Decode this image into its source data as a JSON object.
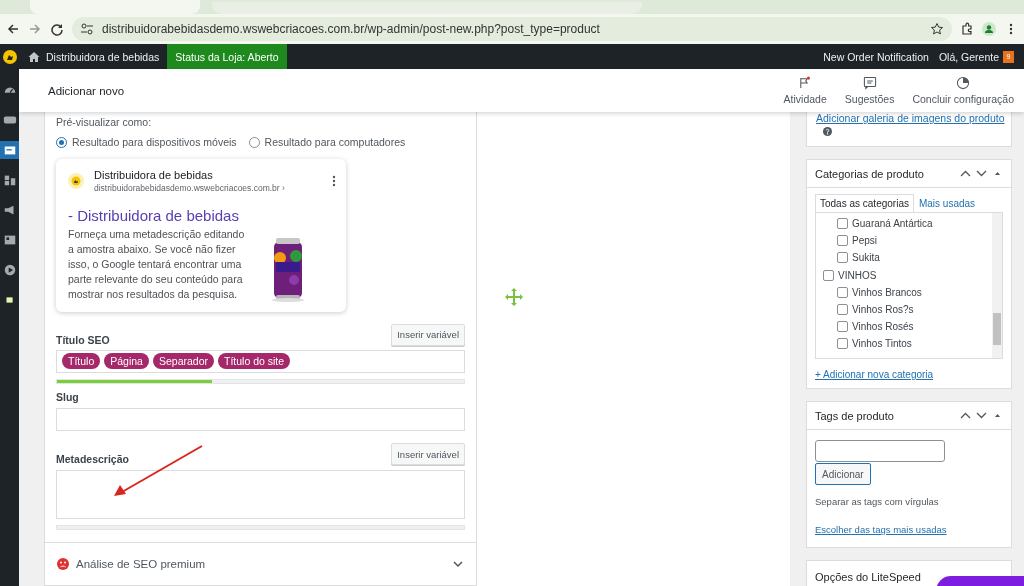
{
  "browser": {
    "url": "distribuidorabebidasdemo.wswebcriacoes.com.br/wp-admin/post-new.php?post_type=product"
  },
  "admin_bar": {
    "site": "Distribuidora de bebidas",
    "store_status": "Status da Loja: Aberto",
    "notification": "New Order Notification",
    "greeting": "Olá, Gerente",
    "badge": "9"
  },
  "header": {
    "title": "Adicionar novo",
    "actions": [
      {
        "label": "Atividade",
        "kind": "flag"
      },
      {
        "label": "Sugestões",
        "kind": "feedback"
      },
      {
        "label": "Concluir configuração",
        "kind": "progress"
      }
    ]
  },
  "sidebar": {
    "items": [
      {
        "kind": "dashboard",
        "selected": false
      },
      {
        "kind": "woo",
        "selected": false
      },
      {
        "kind": "products",
        "selected": true
      },
      {
        "kind": "analytics",
        "selected": false
      },
      {
        "kind": "marketing",
        "selected": false
      },
      {
        "kind": "blocks",
        "selected": false
      },
      {
        "kind": "play",
        "selected": false
      },
      {
        "kind": "square",
        "selected": false
      }
    ]
  },
  "seo": {
    "preview_label": "Pré-visualizar como:",
    "modes": [
      {
        "label": "Resultado para dispositivos móveis",
        "selected": true
      },
      {
        "label": "Resultado para computadores",
        "selected": false
      }
    ],
    "snippet": {
      "site_name": "Distribuidora de bebidas",
      "url": "distribuidorabebidasdemo.wswebcriacoes.com.br ›",
      "title": "- Distribuidora de bebidas",
      "description": "Forneça uma metadescrição editando a amostra abaixo. Se você não fizer isso, o Google tentará encontrar uma parte relevante do seu conteúdo para mostrar nos resultados da pesquisa."
    },
    "title_label": "Título SEO",
    "title_insert": "Inserir variável",
    "title_tags": [
      "Título",
      "Página",
      "Separador",
      "Título do site"
    ],
    "title_progress": {
      "level": 0.38
    },
    "slug_label": "Slug",
    "meta_label": "Metadescrição",
    "meta_insert": "Inserir variável",
    "meta_progress": {
      "level": 0
    },
    "premium": "Análise de SEO premium"
  },
  "gallery": {
    "link": "Adicionar galeria de imagens do produto"
  },
  "categories": {
    "title": "Categorias de produto",
    "tabs": [
      {
        "label": "Todas as categorias",
        "selected": true
      },
      {
        "label": "Mais usadas",
        "selected": false
      }
    ],
    "items": [
      {
        "children": [
          {
            "label": "Guaraná Antártica",
            "checked": false
          },
          {
            "label": "Pepsi",
            "checked": false
          },
          {
            "label": "Sukita",
            "checked": false
          }
        ]
      },
      {
        "label": "VINHOS",
        "checked": false,
        "children": [
          {
            "label": "Vinhos Brancos",
            "checked": false
          },
          {
            "label": "Vinhos Ros?s",
            "checked": false
          },
          {
            "label": "Vinhos Rosés",
            "checked": false
          },
          {
            "label": "Vinhos Tintos",
            "checked": false
          }
        ]
      }
    ],
    "add_link": "+ Adicionar nova categoria"
  },
  "tags": {
    "title": "Tags de produto",
    "button": "Adicionar",
    "hint": "Separar as tags com vírgulas",
    "link": "Escolher das tags mais usadas"
  },
  "litespeed": {
    "title": "Opções do LiteSpeed"
  }
}
